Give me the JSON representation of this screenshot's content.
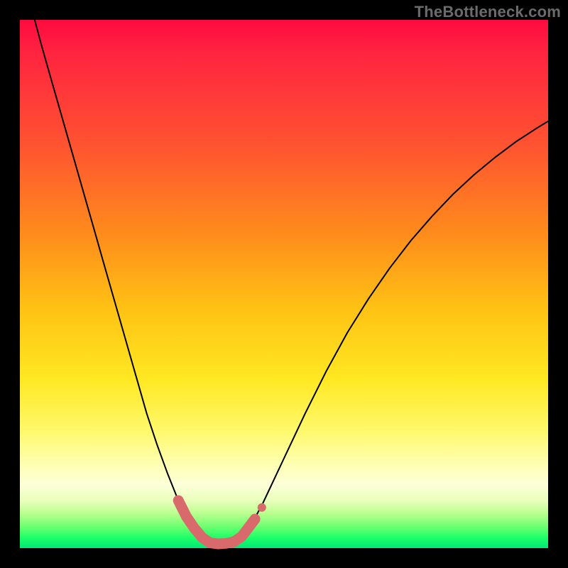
{
  "watermark": "TheBottleneck.com",
  "colors": {
    "frame": "#000000",
    "curve": "#000000",
    "marker": "#d86a6b",
    "gradient_stops": [
      "#ff0b3f",
      "#ff8a1c",
      "#ffe822",
      "#feffb0",
      "#00e876"
    ]
  },
  "chart_data": {
    "type": "line",
    "title": "",
    "xlabel": "",
    "ylabel": "",
    "xlim": [
      0,
      1
    ],
    "ylim": [
      0,
      1
    ],
    "x": [
      0.0,
      0.02,
      0.04,
      0.06,
      0.08,
      0.1,
      0.12,
      0.14,
      0.16,
      0.18,
      0.2,
      0.22,
      0.24,
      0.26,
      0.28,
      0.3,
      0.32,
      0.33,
      0.34,
      0.355,
      0.37,
      0.385,
      0.4,
      0.42,
      0.44,
      0.46,
      0.5,
      0.54,
      0.58,
      0.62,
      0.66,
      0.7,
      0.74,
      0.78,
      0.82,
      0.86,
      0.9,
      0.94,
      0.98,
      1.0
    ],
    "values": [
      1.1,
      1.03,
      0.955,
      0.885,
      0.815,
      0.745,
      0.675,
      0.605,
      0.535,
      0.465,
      0.395,
      0.325,
      0.255,
      0.195,
      0.14,
      0.09,
      0.05,
      0.035,
      0.022,
      0.012,
      0.007,
      0.007,
      0.01,
      0.022,
      0.048,
      0.085,
      0.17,
      0.255,
      0.335,
      0.408,
      0.472,
      0.53,
      0.582,
      0.628,
      0.67,
      0.707,
      0.74,
      0.77,
      0.796,
      0.808
    ],
    "markers": {
      "x": [
        0.3,
        0.315,
        0.33,
        0.345,
        0.36,
        0.375,
        0.39,
        0.405,
        0.42,
        0.445
      ],
      "y": [
        0.09,
        0.06,
        0.038,
        0.02,
        0.01,
        0.008,
        0.009,
        0.012,
        0.022,
        0.055
      ]
    },
    "annotations": []
  }
}
